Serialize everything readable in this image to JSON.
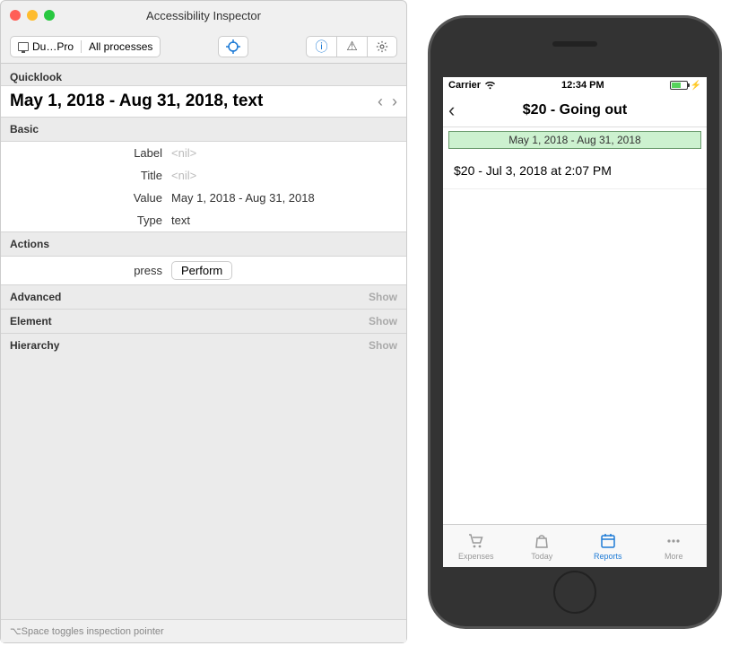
{
  "inspector": {
    "window_title": "Accessibility Inspector",
    "breadcrumb": {
      "first": "Du…Pro",
      "second": "All processes"
    },
    "quicklook_label": "Quicklook",
    "quicklook_value": "May 1, 2018 - Aug 31, 2018, text",
    "sections": {
      "basic": "Basic",
      "actions": "Actions",
      "advanced": "Advanced",
      "element": "Element",
      "hierarchy": "Hierarchy",
      "show": "Show"
    },
    "props": {
      "label_key": "Label",
      "label_val": "<nil>",
      "title_key": "Title",
      "title_val": "<nil>",
      "value_key": "Value",
      "value_val": "May 1, 2018 - Aug 31, 2018",
      "type_key": "Type",
      "type_val": "text"
    },
    "action": {
      "press_key": "press",
      "perform": "Perform"
    },
    "footer": "⌥Space toggles inspection pointer"
  },
  "phone": {
    "status": {
      "carrier": "Carrier",
      "time": "12:34 PM"
    },
    "nav_title": "$20 - Going out",
    "date_banner": "May 1, 2018 - Aug 31, 2018",
    "row1": "$20 - Jul 3, 2018 at 2:07 PM",
    "tabs": {
      "expenses": "Expenses",
      "today": "Today",
      "reports": "Reports",
      "more": "More"
    }
  }
}
